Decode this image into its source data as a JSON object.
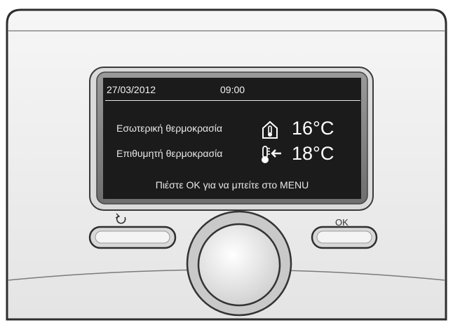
{
  "status_bar": {
    "date": "27/03/2012",
    "time": "09:00"
  },
  "rows": [
    {
      "label": "Εσωτερική θερμοκρασία",
      "icon": "house-thermometer-icon",
      "value": "16°C"
    },
    {
      "label": "Επιθυμητή θερμοκρασία",
      "icon": "target-thermometer-icon",
      "value": "18°C"
    }
  ],
  "message": "Πιέστε OK για να μπείτε στο MENU",
  "buttons": {
    "back_icon": "undo-arrow-icon",
    "ok_label": "OK"
  },
  "colors": {
    "screen_bg": "#1b1b1b",
    "screen_text": "#ffffff",
    "device_body": "#f1f1f1",
    "outline": "#333333"
  }
}
